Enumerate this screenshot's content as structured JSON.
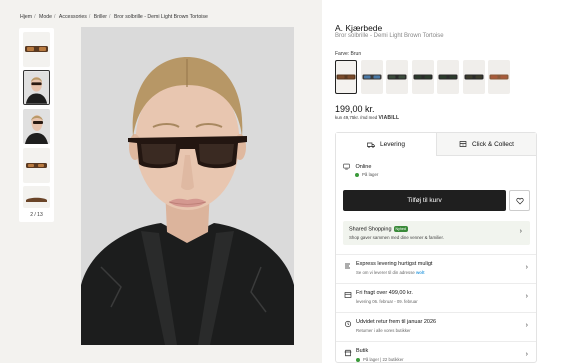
{
  "breadcrumb": [
    "Hjem",
    "Mode",
    "Accessories",
    "Briller",
    "Bror solbrille - Demi Light Brown Tortoise"
  ],
  "gallery": {
    "counter": "2 / 13"
  },
  "product": {
    "brand": "A. Kjærbede",
    "name": "Bror solbrille - Demi Light Brown Tortoise",
    "color_label": "Farve: Brun",
    "price": "199,00 kr.",
    "klarna_prefix": "kun 49,75kr. /md med",
    "klarna_brand": "VIABILL",
    "swatch_lens_colors": [
      "#7a4a2a",
      "#4a7aa8",
      "#3a4a3a",
      "#2a3a2a",
      "#2a3a2a",
      "#3a3a2a",
      "#a85a3a"
    ]
  },
  "tabs": {
    "delivery": "Levering",
    "click_collect": "Click & Collect"
  },
  "online": {
    "title": "Online",
    "stock": "På lager"
  },
  "buttons": {
    "add_to_cart": "Tilføj til kurv"
  },
  "shared": {
    "title": "Shared Shopping",
    "badge": "Nyhed",
    "subtitle": "Shop gaver sammen med dine venner & familier."
  },
  "rows": [
    {
      "title": "Express levering hurtigst muligt",
      "subtitle": "Se om vi leverer til din adresse",
      "extra": "wolt"
    },
    {
      "title": "Fri fragt over 499,00 kr.",
      "subtitle": "levering 06. februar - 09. februar",
      "extra": ""
    },
    {
      "title": "Udvidet retur frem til januar 2026",
      "subtitle": "Returner i alle vores butikker",
      "extra": ""
    },
    {
      "title": "Butik",
      "subtitle": "På lager  |  22 butikker",
      "extra": ""
    }
  ],
  "colors": {
    "accent_dark": "#1f1f1f",
    "stock_green": "#3a9a3a",
    "shared_bg": "#f1f4ee"
  }
}
